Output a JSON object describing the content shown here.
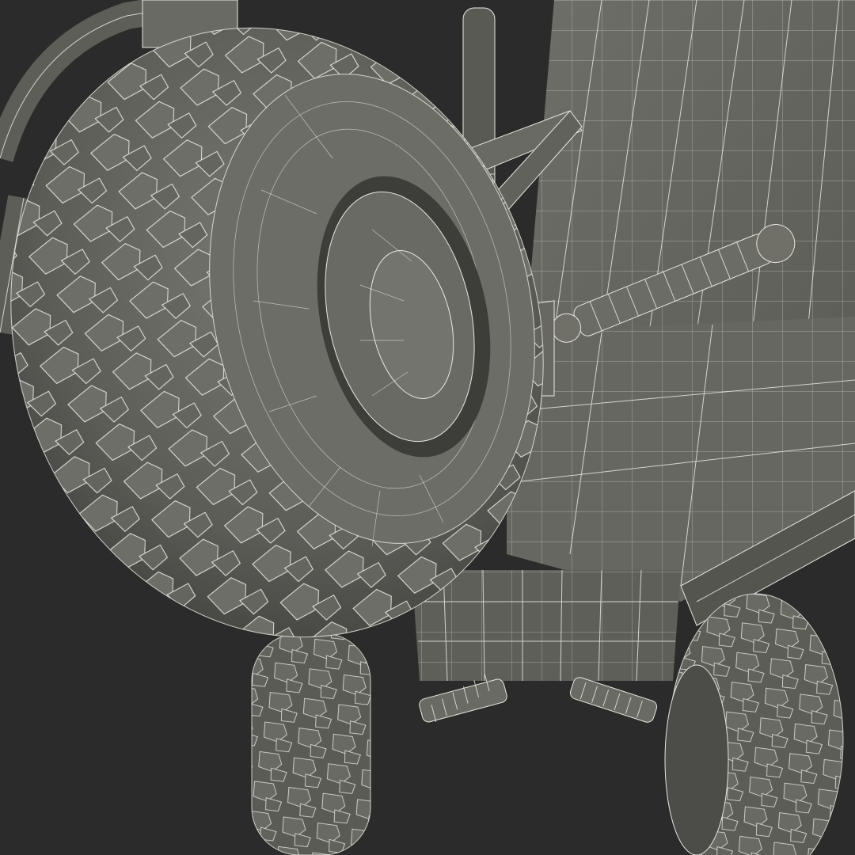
{
  "colors": {
    "background": "#2b2b2b",
    "mesh_dark": "#4a4a46",
    "mesh_mid": "#5e5e59",
    "mesh_light": "#75756f",
    "wireframe": "#e8e8e2"
  }
}
